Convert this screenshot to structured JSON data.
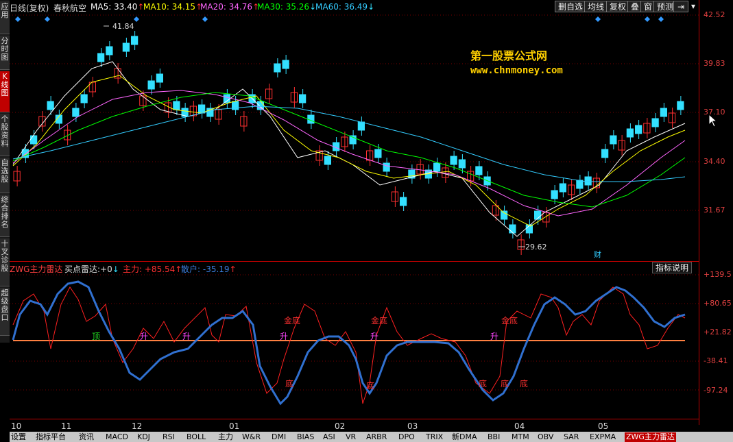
{
  "window": {
    "title": "日线(复权)",
    "stock_name": "春秋航空"
  },
  "ma_legend": [
    {
      "label": "MA5",
      "value": "33.40",
      "dir": "↑",
      "color": "#ffffff"
    },
    {
      "label": "MA10",
      "value": "34.15",
      "dir": "↑",
      "color": "#ffff00"
    },
    {
      "label": "MA20",
      "value": "34.76",
      "dir": "↑",
      "color": "#ff66ff"
    },
    {
      "label": "MA30",
      "value": "35.26",
      "dir": "↓",
      "color": "#00ff00"
    },
    {
      "label": "MA60",
      "value": "36.49",
      "dir": "↓",
      "color": "#33ccff"
    }
  ],
  "toolbar": {
    "delete_watch": "删自选",
    "avg_line": "均线",
    "restore": "复权",
    "overlay": "叠",
    "window": "窗",
    "predict": "预测"
  },
  "sidebar": [
    {
      "label": "应用",
      "active": false
    },
    {
      "label": "分时图",
      "active": false
    },
    {
      "label": "K线图",
      "active": true
    },
    {
      "label": "个股资料",
      "active": false
    },
    {
      "label": "自选股",
      "active": false
    },
    {
      "label": "综合排名",
      "active": false
    },
    {
      "label": "十叉诊股",
      "active": false
    },
    {
      "label": "超级盘口",
      "active": false
    }
  ],
  "price_axis": [
    "42.52",
    "39.83",
    "37.10",
    "34.40",
    "31.67"
  ],
  "price_annotations": {
    "high": "41.84",
    "low": "29.62",
    "finance_mark": "财"
  },
  "watermark": {
    "line1": "第一股票公式网",
    "line2": "www.chnmoney.com"
  },
  "indicator": {
    "name": "ZWG主力雷达",
    "buy_label": "买点雷达:",
    "buy_value": "+0",
    "buy_dir": "↓",
    "main_label": "主力:",
    "main_value": "+85.54",
    "main_dir": "↑",
    "retail_label": "散户:",
    "retail_value": "-35.19",
    "retail_dir": "↑",
    "help": "指标说明"
  },
  "indicator_axis": [
    "+139.5",
    "+80.65",
    "+21.82",
    "-38.41",
    "-97.24"
  ],
  "signals": {
    "top": "顶",
    "rise": "升",
    "gold_bottom": "金底",
    "bottom": "底"
  },
  "x_axis": [
    "10",
    "11",
    "12",
    "01",
    "02",
    "03",
    "04",
    "05"
  ],
  "bottom_tabs": [
    "设置",
    "指标平台",
    "资讯",
    "MACD",
    "KDJ",
    "RSI",
    "BOLL",
    "主力",
    "W&R",
    "DMI",
    "BIAS",
    "ASI",
    "VR",
    "ARBR",
    "DPO",
    "TRIX",
    "新DMA",
    "BBI",
    "MTM",
    "OBV",
    "SAR",
    "EXPMA",
    "ZWG主力雷达"
  ],
  "colors": {
    "up": "#ff3030",
    "down": "#33e0ff",
    "frame": "#c00000",
    "main_line": "#ff2020",
    "retail_line": "#3070d0",
    "zero_line": "#ff8040"
  }
}
